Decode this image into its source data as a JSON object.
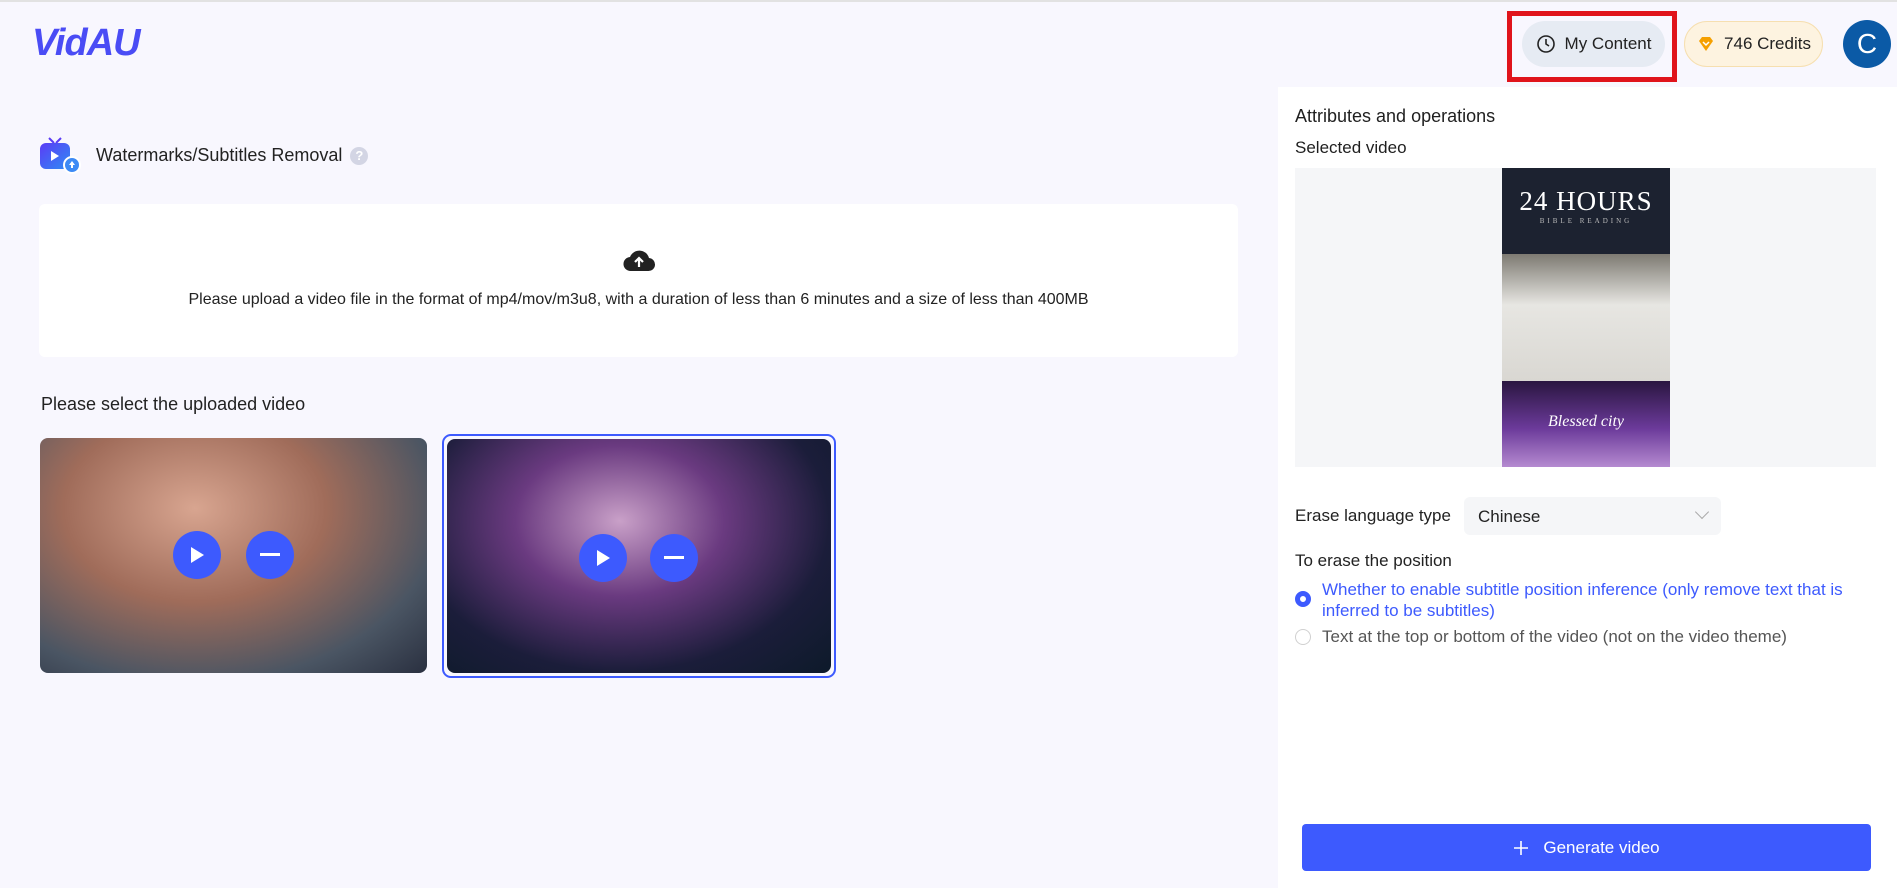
{
  "header": {
    "logo": "VidAU",
    "my_content": "My Content",
    "credits": "746 Credits",
    "avatar_letter": "C"
  },
  "tool": {
    "title": "Watermarks/Subtitles Removal",
    "help": "?"
  },
  "upload": {
    "hint": "Please upload a video file in the format of mp4/mov/m3u8, with a duration of less than 6 minutes and a size of less than 400MB"
  },
  "videos": {
    "label": "Please select the uploaded video",
    "selected_index": 1
  },
  "panel": {
    "title": "Attributes and operations",
    "selected_video_label": "Selected video",
    "preview": {
      "headline": "24 HOURS",
      "subline": "BIBLE READING",
      "signature": "Blessed city"
    },
    "erase_language_label": "Erase language type",
    "erase_language_value": "Chinese",
    "position_label": "To erase the position",
    "options": [
      {
        "label": "Whether to enable subtitle position inference (only remove text that is inferred to be subtitles)",
        "selected": true
      },
      {
        "label": "Text at the top or bottom of the video (not on the video theme)",
        "selected": false
      }
    ],
    "generate": "Generate video"
  },
  "colors": {
    "accent": "#3d5afe",
    "highlight": "#e0141b",
    "avatar": "#0b5aa6"
  }
}
